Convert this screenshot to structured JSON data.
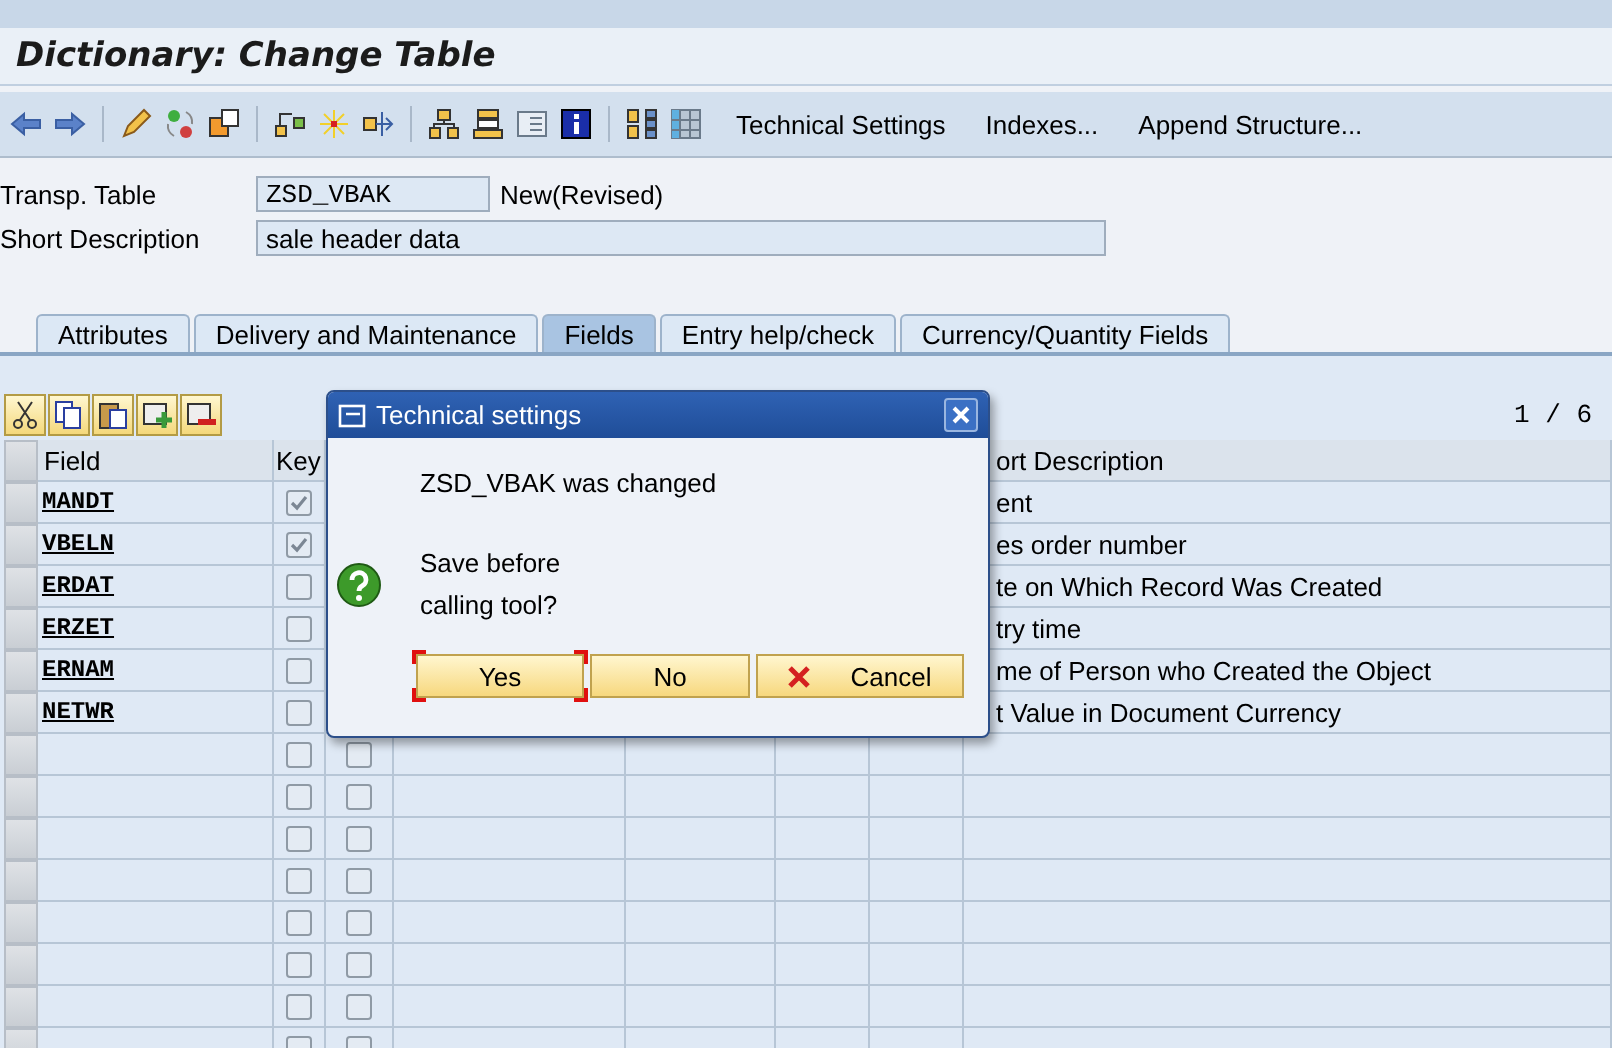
{
  "title": "Dictionary: Change Table",
  "toolbar": {
    "text_buttons": [
      "Technical Settings",
      "Indexes...",
      "Append Structure..."
    ]
  },
  "form": {
    "table_label": "Transp. Table",
    "table_name": "ZSD_VBAK",
    "status": "New(Revised)",
    "description_label": "Short Description",
    "description": "sale header data"
  },
  "tabs": [
    {
      "label": "Attributes",
      "selected": false
    },
    {
      "label": "Delivery and Maintenance",
      "selected": false
    },
    {
      "label": "Fields",
      "selected": true
    },
    {
      "label": "Entry help/check",
      "selected": false
    },
    {
      "label": "Currency/Quantity Fields",
      "selected": false
    }
  ],
  "fields_table": {
    "page": "1 / 6",
    "field_header": "Field",
    "key_header": "Key",
    "description_header": "ort Description",
    "rows": [
      {
        "field": "MANDT",
        "key": true,
        "description": "ent"
      },
      {
        "field": "VBELN",
        "key": true,
        "description": "es order number"
      },
      {
        "field": "ERDAT",
        "key": false,
        "description": "te on Which Record Was Created"
      },
      {
        "field": "ERZET",
        "key": false,
        "description": "try time"
      },
      {
        "field": "ERNAM",
        "key": false,
        "description": "me of Person who Created the Object"
      },
      {
        "field": "NETWR",
        "key": false,
        "description": "t Value in Document Currency"
      },
      {
        "key": false,
        "column_3": false
      },
      {
        "key": false,
        "column_3": false
      },
      {
        "key": false,
        "column_3": false
      },
      {
        "key": false,
        "column_3": false
      },
      {
        "key": false,
        "column_3": false
      },
      {
        "key": false,
        "column_3": false
      },
      {
        "key": false,
        "column_3": false
      },
      {
        "key": false,
        "column_3": false
      }
    ]
  },
  "dialog": {
    "title": "Technical settings",
    "message": "ZSD_VBAK was changed",
    "question": [
      "Save before",
      "calling tool?"
    ],
    "buttons": [
      {
        "label": "Yes",
        "kind": "plain",
        "focused": true
      },
      {
        "label": "No",
        "kind": "plain",
        "focused": false
      },
      {
        "label": "Cancel",
        "kind": "cancel",
        "focused": false
      }
    ]
  }
}
